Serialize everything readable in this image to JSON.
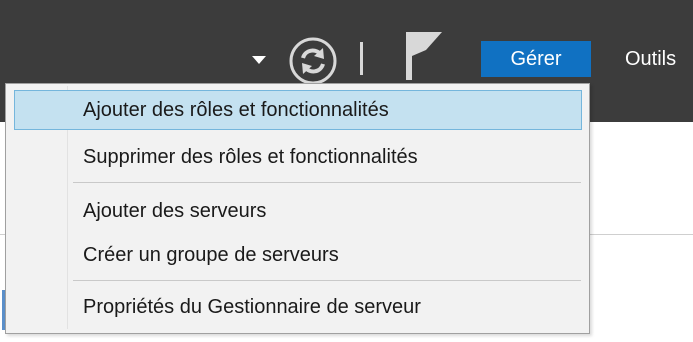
{
  "header": {
    "colors": {
      "background": "#3c3c3c",
      "manage_button": "#1071c2",
      "text": "#ffffff"
    },
    "icons": {
      "dropdown": "caret-down-icon",
      "refresh": "refresh-icon",
      "notifications": "flag-icon"
    },
    "manage_label": "Gérer",
    "tools_label": "Outils"
  },
  "menu": {
    "highlight_color": "#c4e1f0",
    "groups": [
      [
        "Ajouter des rôles et fonctionnalités",
        "Supprimer des rôles et fonctionnalités"
      ],
      [
        "Ajouter des serveurs",
        "Créer un groupe de serveurs"
      ],
      [
        "Propriétés du Gestionnaire de serveur"
      ]
    ]
  }
}
